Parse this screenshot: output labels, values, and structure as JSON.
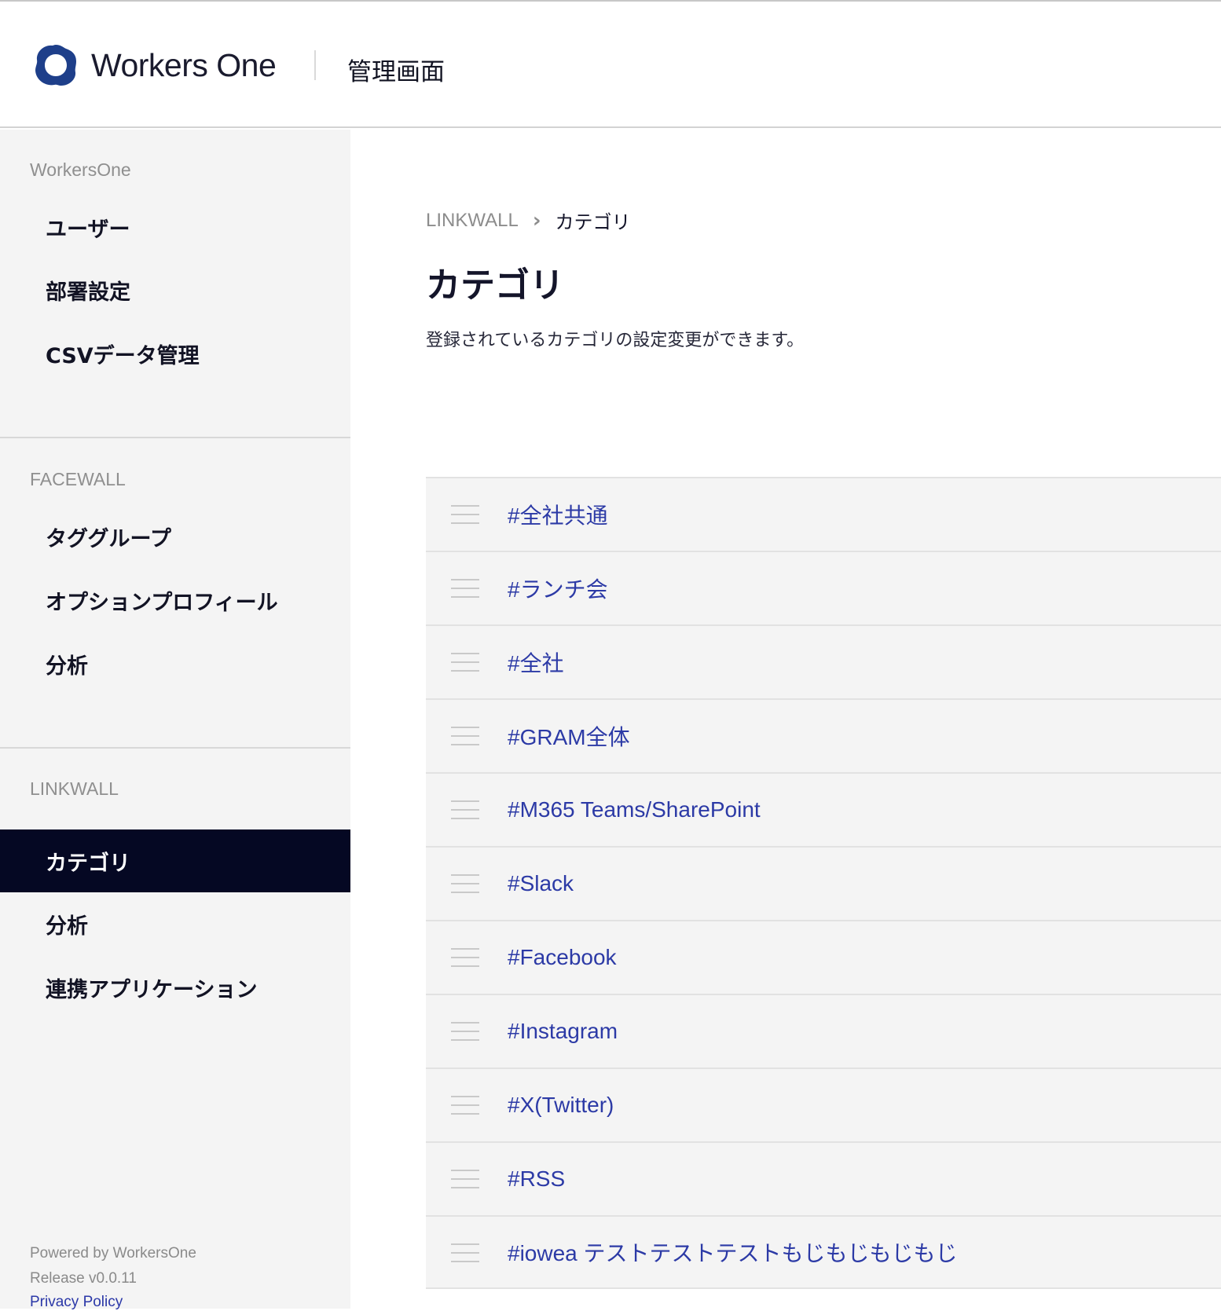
{
  "header": {
    "brand": "Workers One",
    "title": "管理画面"
  },
  "sidebar": {
    "sections": [
      {
        "label": "WorkersOne",
        "items": [
          {
            "label": "ユーザー"
          },
          {
            "label": "部署設定"
          },
          {
            "label": "CSVデータ管理"
          }
        ]
      },
      {
        "label": "FACEWALL",
        "items": [
          {
            "label": "タググループ"
          },
          {
            "label": "オプションプロフィール"
          },
          {
            "label": "分析"
          }
        ]
      },
      {
        "label": "LINKWALL",
        "items": [
          {
            "label": "カテゴリ",
            "active": true
          },
          {
            "label": "分析"
          },
          {
            "label": "連携アプリケーション"
          }
        ]
      }
    ],
    "footer": {
      "powered_by": "Powered by WorkersOne",
      "release": "Release v0.0.11",
      "privacy": "Privacy Policy"
    }
  },
  "main": {
    "breadcrumb": {
      "parent": "LINKWALL",
      "current": "カテゴリ"
    },
    "title": "カテゴリ",
    "description": "登録されているカテゴリの設定変更ができます。",
    "categories": [
      {
        "label": "#全社共通"
      },
      {
        "label": "#ランチ会"
      },
      {
        "label": "#全社"
      },
      {
        "label": "#GRAM全体"
      },
      {
        "label": "#M365 Teams/SharePoint"
      },
      {
        "label": "#Slack"
      },
      {
        "label": "#Facebook"
      },
      {
        "label": "#Instagram"
      },
      {
        "label": "#X(Twitter)"
      },
      {
        "label": "#RSS"
      },
      {
        "label": "#iowea テストテストテストもじもじもじもじ"
      }
    ]
  },
  "colors": {
    "active_nav_bg": "#050823",
    "link": "#2c3aa6",
    "logo": "#1e3f8a"
  }
}
